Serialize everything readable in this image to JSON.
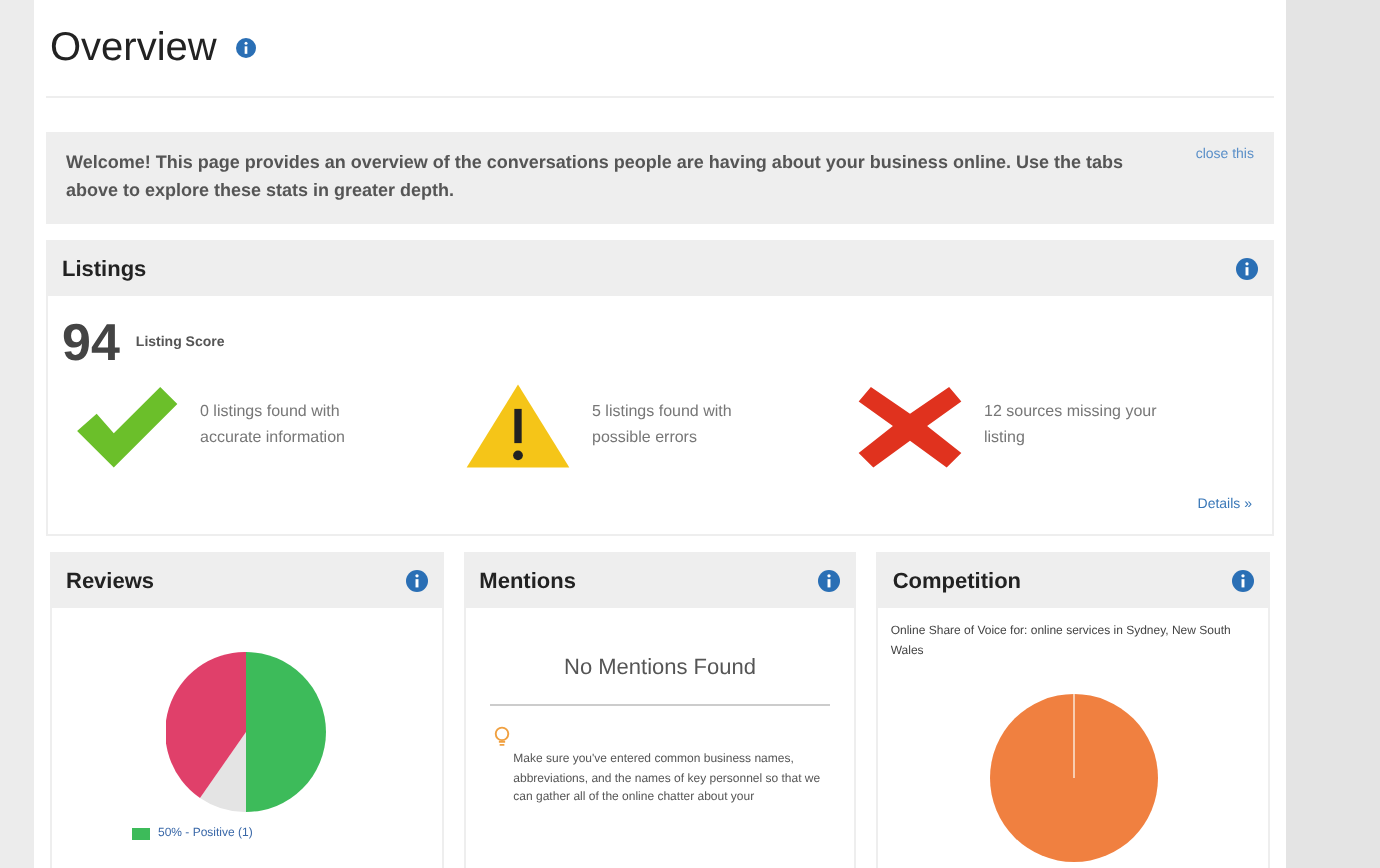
{
  "page": {
    "title": "Overview"
  },
  "welcome": {
    "text": "Welcome! This page provides an overview of the conversations people are having about your business online. Use the tabs above to explore these stats in greater depth.",
    "close_link": "close this"
  },
  "listings": {
    "title": "Listings",
    "score": "94",
    "score_label": "Listing Score",
    "stats": [
      {
        "kind": "ok",
        "text": "0 listings found with accurate information"
      },
      {
        "kind": "warning",
        "text": "5 listings found with possible errors"
      },
      {
        "kind": "missing",
        "text": "12 sources missing your listing"
      }
    ],
    "details_link": "Details »"
  },
  "reviews": {
    "title": "Reviews",
    "legend": [
      {
        "color": "#3dbb5a",
        "text": "50% - Positive (1)"
      }
    ]
  },
  "mentions": {
    "title": "Mentions",
    "empty": "No Mentions Found",
    "tip": "Make sure you've entered common business names, abbreviations, and the names of key personnel so that we can gather all of the online chatter about your"
  },
  "competition": {
    "title": "Competition",
    "caption": "Online Share of Voice for: online services in Sydney, New South Wales"
  }
}
